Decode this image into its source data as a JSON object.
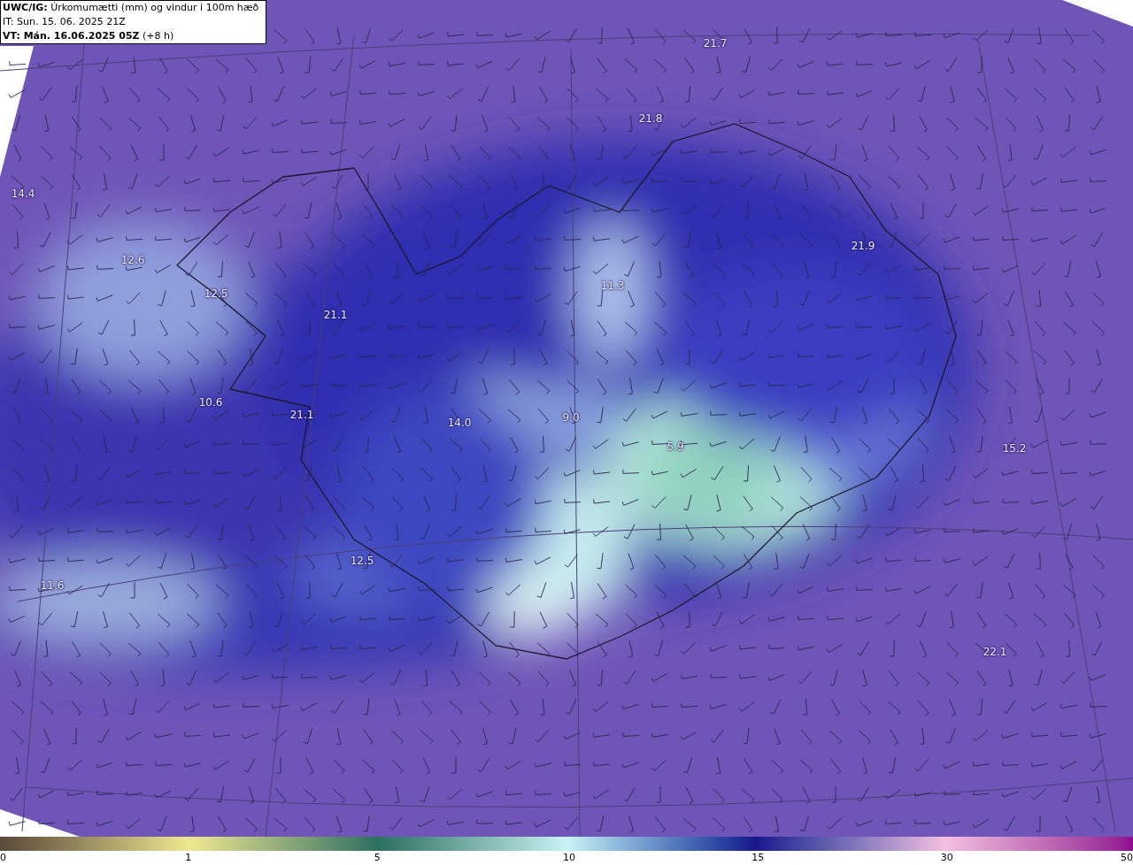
{
  "header": {
    "model": "UWC/IG:",
    "title": "Úrkomumætti (mm) og vindur i 100m hæð",
    "issue_time": "IT: Sun. 15. 06. 2025 21Z",
    "valid_time": "VT: Mán. 16.06.2025 05Z",
    "lead": "(+8 h)"
  },
  "map_labels": [
    "21.7",
    "21.8",
    "14.4",
    "12.6",
    "12.5",
    "21.1",
    "11.3",
    "21.9",
    "10.6",
    "21.1",
    "14.0",
    "9.0",
    "5.9",
    "15.2",
    "12.5",
    "11.6",
    "22.1"
  ],
  "colorbar": {
    "ticks": [
      "0",
      "1",
      "5",
      "10",
      "15",
      "30",
      "50"
    ]
  }
}
